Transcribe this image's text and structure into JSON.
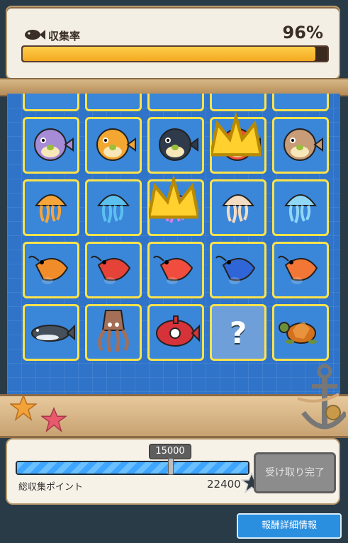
{
  "collection": {
    "label": "収集率",
    "percent_text": "96%",
    "progress": 0.96,
    "icon": "fish-icon"
  },
  "grid": {
    "cells": [
      {
        "kind": "fish",
        "color": "#f6a4bd"
      },
      {
        "kind": "fish",
        "color": "#f18db0"
      },
      {
        "kind": "fish",
        "color": "#e76b5c"
      },
      {
        "kind": "fish",
        "color": "#7b5cc3"
      },
      {
        "kind": "fish",
        "color": "#dc4c5f"
      },
      {
        "kind": "pufferfish",
        "color": "#a68bd6"
      },
      {
        "kind": "pufferfish",
        "color": "#f3a731"
      },
      {
        "kind": "pufferfish",
        "color": "#2f3b4a"
      },
      {
        "kind": "pufferfish",
        "color": "#f24b3b",
        "crown": true
      },
      {
        "kind": "pufferfish",
        "color": "#c89c76"
      },
      {
        "kind": "jellyfish",
        "color": "#f6a53b"
      },
      {
        "kind": "jellyfish",
        "color": "#5cc0ef"
      },
      {
        "kind": "jellyfish",
        "color": "#c982e8",
        "crown": true
      },
      {
        "kind": "jellyfish",
        "color": "#f3dcc1"
      },
      {
        "kind": "jellyfish",
        "color": "#8fd7f5"
      },
      {
        "kind": "shrimp",
        "color": "#f18c2a"
      },
      {
        "kind": "shrimp",
        "color": "#e54238"
      },
      {
        "kind": "shrimp",
        "color": "#f04d3e"
      },
      {
        "kind": "shrimp",
        "color": "#2f65d6"
      },
      {
        "kind": "shrimp",
        "color": "#f27635"
      },
      {
        "kind": "whale",
        "color": "#45505a"
      },
      {
        "kind": "squid",
        "color": "#a46f57"
      },
      {
        "kind": "submarine",
        "color": "#d6323a"
      },
      {
        "kind": "unknown",
        "label": "?"
      },
      {
        "kind": "turtle",
        "color": "#d3711f"
      }
    ]
  },
  "points": {
    "threshold": "15000",
    "label": "総収集ポイント",
    "value": "22400",
    "fill": 1.0,
    "marker": 0.67,
    "claim_button": "受け取り完了",
    "detail_button": "報酬詳細情報"
  },
  "colors": {
    "accent": "#f4a821",
    "grid_bg": "#2f74c9",
    "cell_border": "#ffe34a"
  }
}
